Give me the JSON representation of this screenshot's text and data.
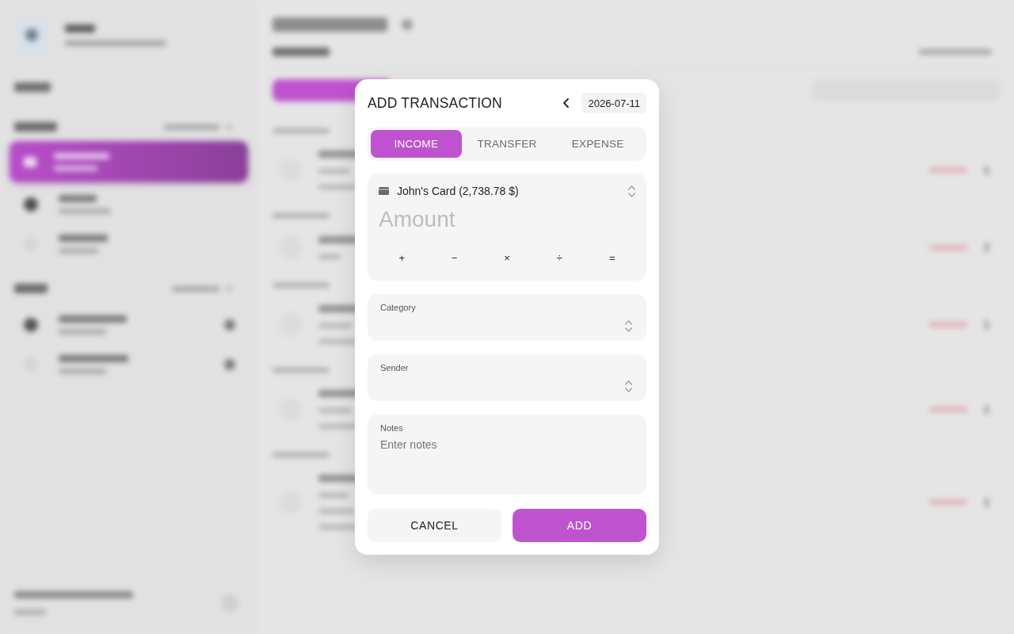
{
  "dialog": {
    "title": "ADD TRANSACTION",
    "date": "2026-07-11",
    "tabs": [
      {
        "label": "INCOME",
        "selected": true
      },
      {
        "label": "TRANSFER",
        "selected": false
      },
      {
        "label": "EXPENSE",
        "selected": false
      }
    ],
    "account": {
      "label": "John's Card (2,738.78 $)"
    },
    "amount": {
      "placeholder": "Amount"
    },
    "operators": [
      "+",
      "−",
      "×",
      "÷",
      "="
    ],
    "fields": [
      {
        "kind": "select",
        "label": "Category"
      },
      {
        "kind": "select",
        "label": "Sender"
      },
      {
        "kind": "textarea",
        "label": "Notes",
        "placeholder": "Enter notes"
      }
    ],
    "buttons": [
      {
        "kind": "secondary",
        "label": "CANCEL"
      },
      {
        "kind": "primary",
        "label": "ADD"
      }
    ]
  }
}
